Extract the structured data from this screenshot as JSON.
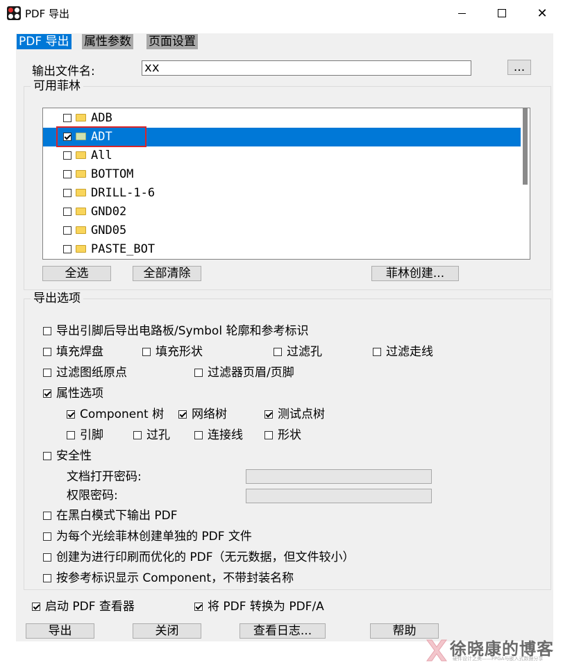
{
  "window": {
    "title": "PDF 导出",
    "minimize": "minimize",
    "maximize": "maximize",
    "close": "close"
  },
  "tabs": [
    {
      "label": "PDF 导出",
      "active": true
    },
    {
      "label": "属性参数",
      "active": false
    },
    {
      "label": "页面设置",
      "active": false
    }
  ],
  "output": {
    "label": "输出文件名:",
    "value": "xx",
    "browse_label": "..."
  },
  "films": {
    "group_title": "可用菲林",
    "items": [
      {
        "name": "ADB",
        "checked": false,
        "selected": false
      },
      {
        "name": "ADT",
        "checked": true,
        "selected": true
      },
      {
        "name": "All",
        "checked": false,
        "selected": false
      },
      {
        "name": "BOTTOM",
        "checked": false,
        "selected": false
      },
      {
        "name": "DRILL-1-6",
        "checked": false,
        "selected": false
      },
      {
        "name": "GND02",
        "checked": false,
        "selected": false
      },
      {
        "name": "GND05",
        "checked": false,
        "selected": false
      },
      {
        "name": "PASTE_BOT",
        "checked": false,
        "selected": false
      }
    ],
    "select_all": "全选",
    "clear_all": "全部清除",
    "create_film": "菲林创建..."
  },
  "export_options": {
    "group_title": "导出选项",
    "pin_outline": "导出引脚后导出电路板/Symbol 轮廓和参考标识",
    "fill_pads": "填充焊盘",
    "fill_shapes": "填充形状",
    "filter_holes": "过滤孔",
    "filter_traces": "过滤走线",
    "filter_origin": "过滤图纸原点",
    "filter_header_footer": "过滤器页眉/页脚",
    "property_options": "属性选项",
    "component_tree": "Component 树",
    "net_tree": "网络树",
    "testpoint_tree": "测试点树",
    "pins": "引脚",
    "vias": "过孔",
    "connect_lines": "连接线",
    "shapes": "形状",
    "security": "安全性",
    "open_password_label": "文档打开密码:",
    "permission_password_label": "权限密码:",
    "bw_output": "在黑白模式下输出 PDF",
    "per_film_pdf": "为每个光绘菲林创建单独的 PDF 文件",
    "print_optimized": "创建为进行印刷而优化的 PDF（无元数据，但文件较小）",
    "show_by_refdes": "按参考标识显示 Component，不带封装名称"
  },
  "bottom_options": {
    "launch_viewer": "启动 PDF 查看器",
    "convert_pdfa": "将 PDF 转换为 PDF/A"
  },
  "buttons": {
    "export": "导出",
    "close": "关闭",
    "view_log": "查看日志...",
    "help": "帮助"
  },
  "watermark": {
    "text": "徐晓康的博客",
    "subtitle": "硬件设计之美——FPGA与嵌入式数据分享"
  }
}
